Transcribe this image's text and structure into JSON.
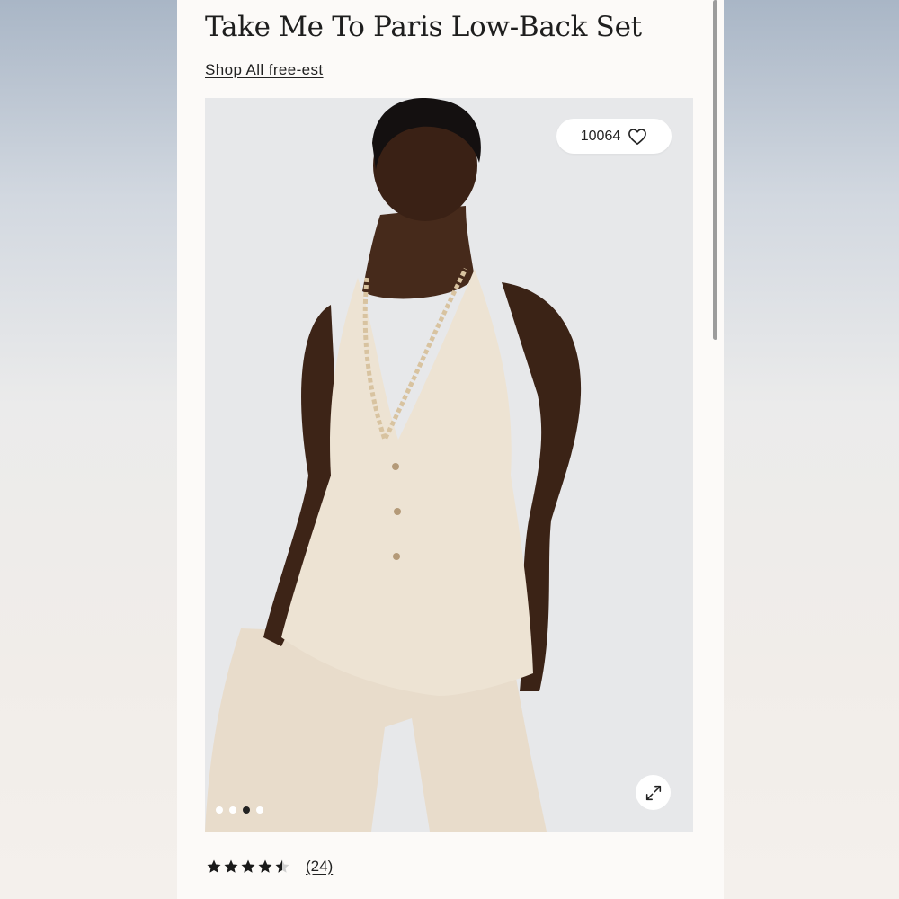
{
  "product": {
    "title": "Take Me To Paris Low-Back Set",
    "shop_link": "Shop All free-est"
  },
  "gallery": {
    "wishlist_count": "10064",
    "wishlist_icon": "heart-icon",
    "expand_icon": "expand-icon",
    "slide_count": 4,
    "active_slide": 3
  },
  "reviews": {
    "rating": 4.5,
    "max_rating": 5,
    "count_label": "(24)"
  },
  "colors": {
    "page_background": "#fcfaf8",
    "text": "#1e1e1e",
    "star": "#1a1a1a",
    "active_dot": "#222222",
    "inactive_dot": "#ffffff"
  }
}
